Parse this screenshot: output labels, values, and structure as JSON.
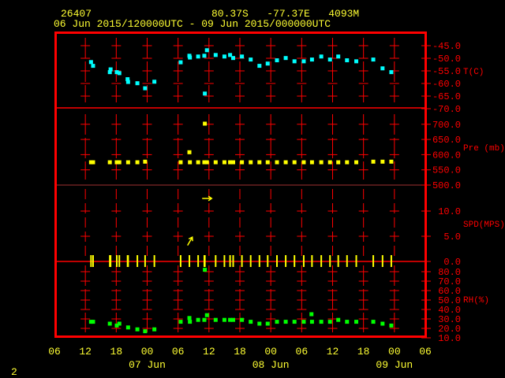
{
  "header": {
    "station_id": "26407",
    "location": "80.37S   -77.37E   4093M",
    "time_range": "06 Jun 2015/120000UTC - 09 Jun 2015/000000UTC",
    "page_number": "2"
  },
  "colors": {
    "frame": "#ff0000",
    "text": "#ffff33",
    "temperature": "#00ffff",
    "pressure": "#ffff00",
    "wind": "#ffff00",
    "humidity": "#00ff00"
  },
  "chart_data": {
    "type": "scatter",
    "x_axis": {
      "range": [
        "2015-06-06T06:00Z",
        "2015-06-09T06:00Z"
      ],
      "tick_labels": [
        "06",
        "12",
        "18",
        "00",
        "06",
        "12",
        "18",
        "00",
        "06",
        "12",
        "18",
        "00",
        "06"
      ],
      "date_labels": [
        {
          "label": "07 Jun",
          "at": "2015-06-07T00:00Z"
        },
        {
          "label": "08 Jun",
          "at": "2015-06-08T00:00Z"
        },
        {
          "label": "09 Jun",
          "at": "2015-06-09T00:00Z"
        }
      ]
    },
    "panels": [
      {
        "key": "T",
        "label": "T(C)",
        "range": [
          -70,
          -45
        ],
        "ticks": [
          "-45.0",
          "-50.0",
          "-55.0",
          "-60.0",
          "-65.0",
          "-70.0"
        ]
      },
      {
        "key": "P",
        "label": "Pre (mb)",
        "range": [
          500,
          700
        ],
        "ticks": [
          "700.0",
          "650.0",
          "600.0",
          "550.0",
          "500.0"
        ]
      },
      {
        "key": "SPD",
        "label": "SPD(MPS)",
        "range": [
          0,
          15
        ],
        "ticks": [
          "10.0",
          "5.0",
          "0.0"
        ]
      },
      {
        "key": "RH",
        "label": "RH(%)",
        "range": [
          10,
          80
        ],
        "ticks": [
          "80.0",
          "70.0",
          "60.0",
          "50.0",
          "40.0",
          "30.0",
          "20.0",
          "10.0"
        ]
      }
    ],
    "observations": [
      {
        "t": "2015-06-06T13:06Z",
        "T": -51.5,
        "P": 575,
        "RH": 27,
        "SPD": 0
      },
      {
        "t": "2015-06-06T13:30Z",
        "T": -53.0,
        "P": 575,
        "RH": 27,
        "SPD": 0
      },
      {
        "t": "2015-06-06T16:45Z",
        "T": -55.5,
        "P": 575,
        "RH": 25,
        "SPD": 0
      },
      {
        "t": "2015-06-06T16:54Z",
        "T": -54.4,
        "P": null,
        "RH": null,
        "SPD": 0
      },
      {
        "t": "2015-06-06T18:06Z",
        "T": -55.5,
        "P": 575,
        "RH": 23,
        "SPD": 0
      },
      {
        "t": "2015-06-06T18:36Z",
        "T": -55.9,
        "P": 575,
        "RH": 25,
        "SPD": 0
      },
      {
        "t": "2015-06-06T20:12Z",
        "T": -58.3,
        "P": null,
        "RH": null,
        "SPD": 0
      },
      {
        "t": "2015-06-06T20:18Z",
        "T": -59.4,
        "P": 575,
        "RH": 21,
        "SPD": 0
      },
      {
        "t": "2015-06-06T22:06Z",
        "T": -59.9,
        "P": 575,
        "RH": 19,
        "SPD": 0
      },
      {
        "t": "2015-06-06T23:36Z",
        "T": -61.9,
        "P": 577,
        "RH": 17,
        "SPD": 0
      },
      {
        "t": "2015-06-07T01:24Z",
        "T": -59.3,
        "P": null,
        "RH": 19,
        "SPD": 0
      },
      {
        "t": "2015-06-07T06:30Z",
        "T": -51.6,
        "P": 575,
        "RH": 27,
        "SPD": 0
      },
      {
        "t": "2015-06-07T08:12Z",
        "T": -49.0,
        "P": 608,
        "RH": 31,
        "SPD": 0
      },
      {
        "t": "2015-06-07T08:18Z",
        "T": -49.7,
        "P": 575,
        "RH": 27,
        "SPD": 4,
        "DIR": 210
      },
      {
        "t": "2015-06-07T09:54Z",
        "T": -49.3,
        "P": 575,
        "RH": 29,
        "SPD": 0
      },
      {
        "t": "2015-06-07T11:06Z",
        "T": -49.0,
        "P": 575,
        "RH": 29,
        "SPD": 0
      },
      {
        "t": "2015-06-07T11:12Z",
        "T": -64.0,
        "P": 702,
        "RH": 82,
        "SPD": 0
      },
      {
        "t": "2015-06-07T11:36Z",
        "T": -46.8,
        "P": 575,
        "RH": 34,
        "SPD": 12.5,
        "DIR": 270
      },
      {
        "t": "2015-06-07T13:18Z",
        "T": -48.7,
        "P": 575,
        "RH": 29,
        "SPD": 0
      },
      {
        "t": "2015-06-07T15:00Z",
        "T": -49.3,
        "P": 575,
        "RH": 29,
        "SPD": 0
      },
      {
        "t": "2015-06-07T16:06Z",
        "T": -48.7,
        "P": 575,
        "RH": 29,
        "SPD": 0
      },
      {
        "t": "2015-06-07T16:42Z",
        "T": -49.9,
        "P": 575,
        "RH": 29,
        "SPD": 0
      },
      {
        "t": "2015-06-07T18:24Z",
        "T": -49.3,
        "P": 575,
        "RH": 29,
        "SPD": 0
      },
      {
        "t": "2015-06-07T20:06Z",
        "T": -50.5,
        "P": 575,
        "RH": 27,
        "SPD": 0
      },
      {
        "t": "2015-06-07T21:48Z",
        "T": -53.0,
        "P": 575,
        "RH": 25,
        "SPD": 0
      },
      {
        "t": "2015-06-07T23:24Z",
        "T": -52.1,
        "P": 575,
        "RH": 25,
        "SPD": 0
      },
      {
        "t": "2015-06-08T01:12Z",
        "T": -50.8,
        "P": 575,
        "RH": 27,
        "SPD": 0
      },
      {
        "t": "2015-06-08T02:54Z",
        "T": -49.9,
        "P": 575,
        "RH": 27,
        "SPD": 0
      },
      {
        "t": "2015-06-08T04:36Z",
        "T": -51.2,
        "P": 575,
        "RH": 27,
        "SPD": 0
      },
      {
        "t": "2015-06-08T06:24Z",
        "T": -51.2,
        "P": 575,
        "RH": 27,
        "SPD": 0
      },
      {
        "t": "2015-06-08T07:54Z",
        "T": null,
        "P": null,
        "RH": 35,
        "SPD": null
      },
      {
        "t": "2015-06-08T08:00Z",
        "T": -50.5,
        "P": 575,
        "RH": 27,
        "SPD": 0
      },
      {
        "t": "2015-06-08T09:48Z",
        "T": -49.3,
        "P": 575,
        "RH": 27,
        "SPD": 0
      },
      {
        "t": "2015-06-08T11:30Z",
        "T": -50.5,
        "P": 575,
        "RH": 27,
        "SPD": 0
      },
      {
        "t": "2015-06-08T13:06Z",
        "T": -49.3,
        "P": 575,
        "RH": 29,
        "SPD": 0
      },
      {
        "t": "2015-06-08T14:48Z",
        "T": -50.8,
        "P": 575,
        "RH": 27,
        "SPD": 0
      },
      {
        "t": "2015-06-08T16:36Z",
        "T": -51.2,
        "P": 575,
        "RH": 27,
        "SPD": 0
      },
      {
        "t": "2015-06-08T19:54Z",
        "T": -50.5,
        "P": 577,
        "RH": 27,
        "SPD": 0
      },
      {
        "t": "2015-06-08T21:42Z",
        "T": -54.0,
        "P": 577,
        "RH": 25,
        "SPD": 0
      },
      {
        "t": "2015-06-08T23:24Z",
        "T": -55.5,
        "P": 577,
        "RH": 23,
        "SPD": 0
      }
    ]
  }
}
